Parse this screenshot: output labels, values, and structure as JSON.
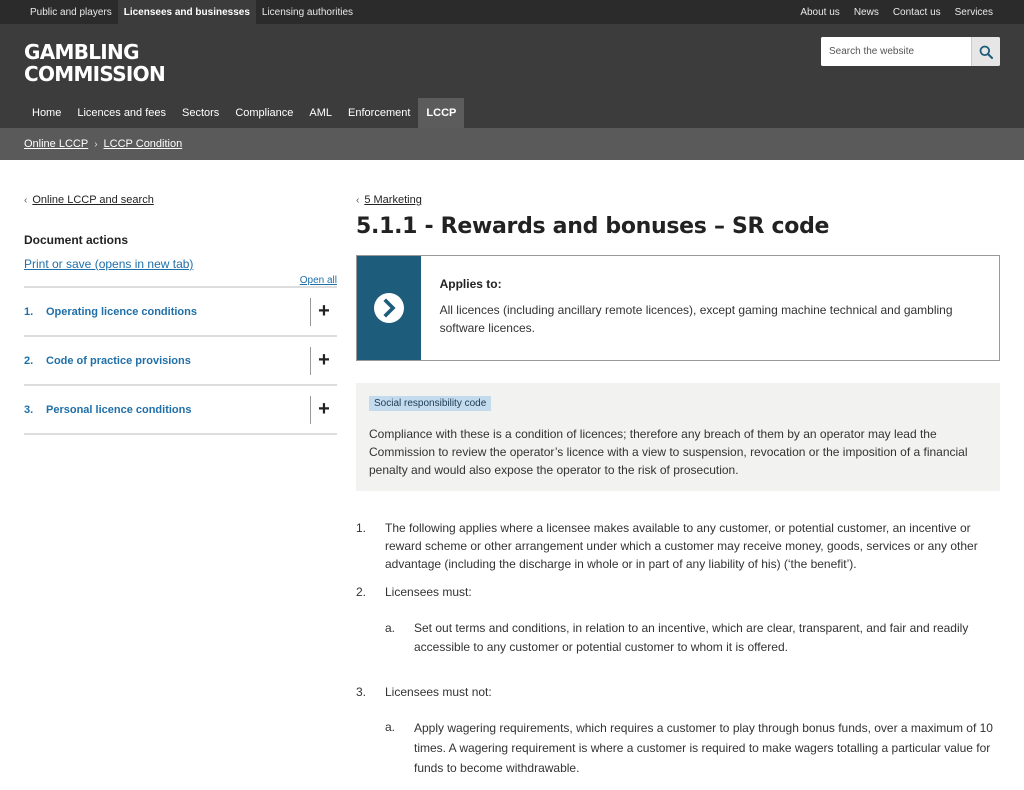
{
  "topbar": {
    "left": [
      {
        "label": "Public and players",
        "active": false
      },
      {
        "label": "Licensees and businesses",
        "active": true
      },
      {
        "label": "Licensing authorities",
        "active": false
      }
    ],
    "right": [
      "About us",
      "News",
      "Contact us",
      "Services"
    ]
  },
  "header": {
    "logo_line1": "GAMBLING",
    "logo_line2": "COMMISSION",
    "search_placeholder": "Search the website",
    "search_icon": "magnifier-icon"
  },
  "mainnav": [
    "Home",
    "Licences and fees",
    "Sectors",
    "Compliance",
    "AML",
    "Enforcement",
    "LCCP"
  ],
  "mainnav_active": "LCCP",
  "breadcrumb": [
    "Online LCCP",
    "LCCP Condition"
  ],
  "sidebar": {
    "back_link": "Online LCCP and search",
    "doc_actions": "Document actions",
    "print_link": "Print or save (opens in new tab)",
    "open_all": "Open all",
    "items": [
      {
        "num": "1.",
        "label": "Operating licence conditions"
      },
      {
        "num": "2.",
        "label": "Code of practice provisions"
      },
      {
        "num": "3.",
        "label": "Personal licence conditions"
      }
    ]
  },
  "content": {
    "back_link": "5 Marketing",
    "title": "5.1.1 - Rewards and bonuses – SR code",
    "applies_title": "Applies to:",
    "applies_body": "All licences (including ancillary remote licences), except gaming machine technical and gambling software licences.",
    "sr_tag": "Social responsibility code",
    "sr_text": "Compliance with these is a condition of licences; therefore any breach of them by an operator may lead the Commission to review the operator’s licence with a view to suspension, revocation or the imposition of a financial penalty and would also expose the operator to the risk of prosecution.",
    "items": [
      {
        "num": "1.",
        "text": "The following applies where a licensee makes available to any customer, or potential customer, an incentive or reward scheme or other arrangement under which a customer may receive money, goods, services or any other advantage (including the discharge in whole or in part of any liability of his) (‘the benefit’)."
      },
      {
        "num": "2.",
        "text": "Licensees must:",
        "sub_num": "a.",
        "sub_text": "Set out terms and conditions, in relation to an incentive, which are clear, transparent, and fair and readily accessible to any customer or potential customer to whom it is offered."
      },
      {
        "num": "3.",
        "text": "Licensees must not:",
        "sub_num": "a.",
        "sub_text": "Apply wagering requirements, which requires a customer to play through bonus funds, over a maximum of 10 times. A wagering requirement is where a customer is required to make wagers totalling a particular value for funds to become withdrawable."
      }
    ]
  },
  "colors": {
    "topbar": "#2b2b2b",
    "header": "#3c3c3c",
    "breadcrumb": "#5a5a5a",
    "link": "#1f6fa8",
    "applies_icon_bg": "#1d5c7a",
    "sr_tag_bg": "#c4dbee"
  }
}
